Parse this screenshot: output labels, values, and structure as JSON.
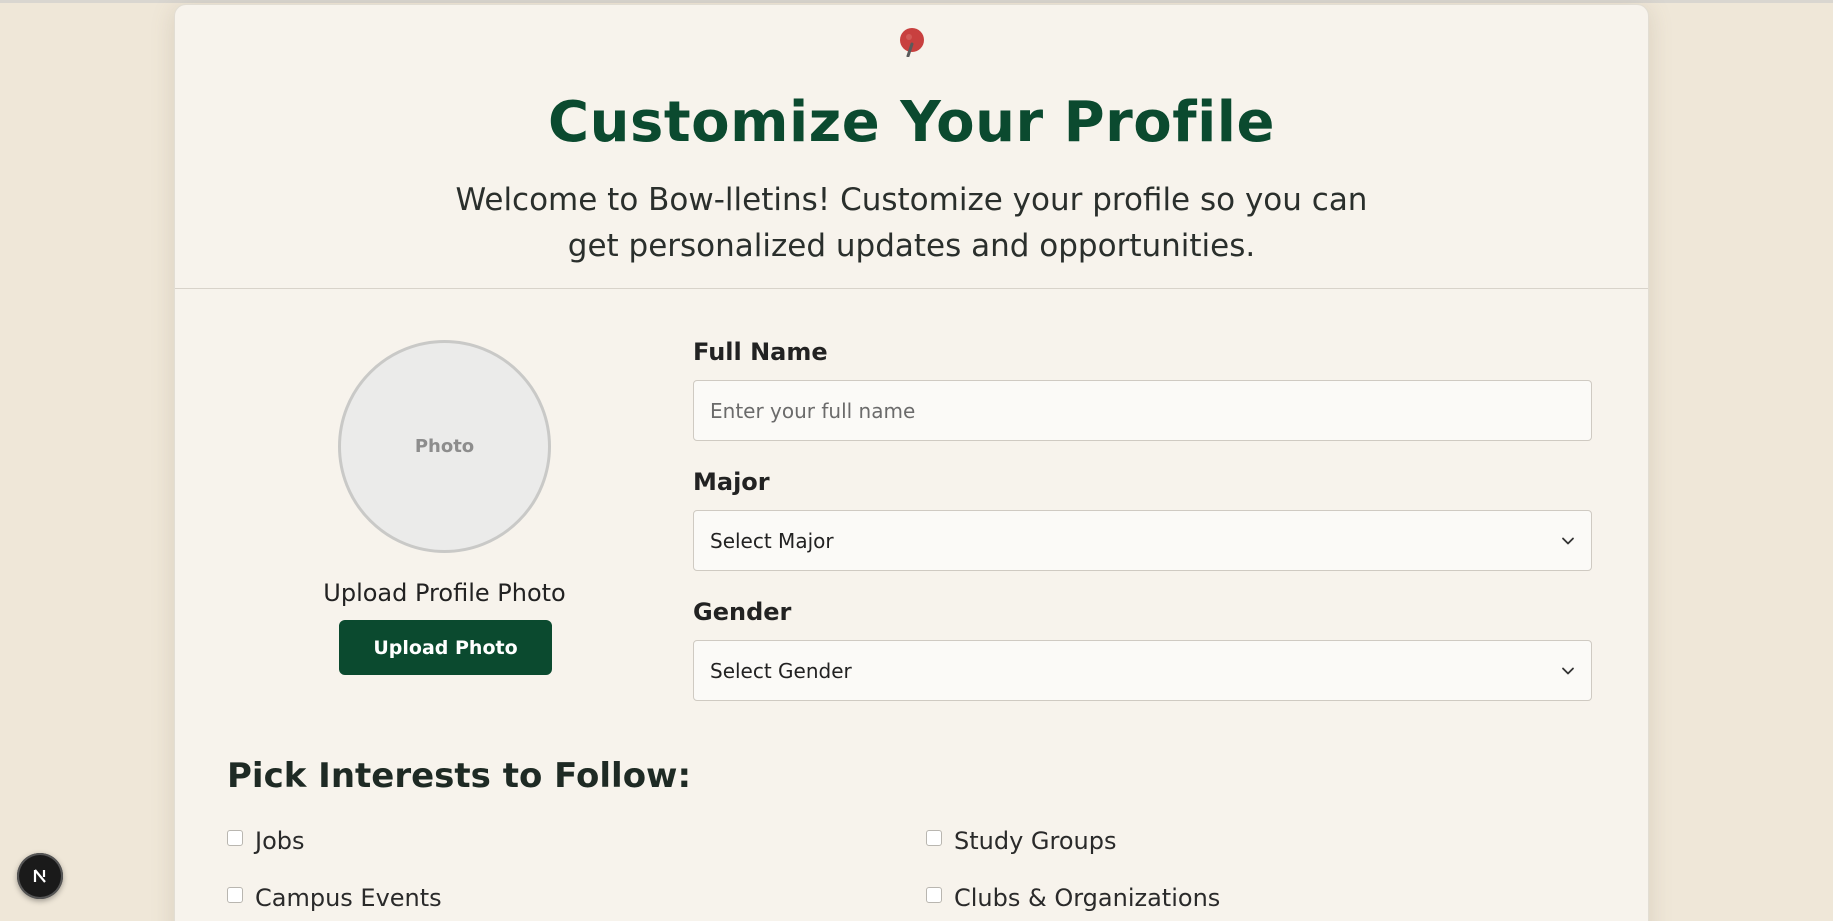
{
  "header": {
    "title": "Customize Your Profile",
    "subtitle": "Welcome to Bow-lletins! Customize your profile so you can get personalized updates and opportunities."
  },
  "photo": {
    "placeholder": "Photo",
    "upload_label": "Upload Profile Photo",
    "upload_button": "Upload Photo"
  },
  "form": {
    "full_name": {
      "label": "Full Name",
      "placeholder": "Enter your full name",
      "value": ""
    },
    "major": {
      "label": "Major",
      "selected": "Select Major"
    },
    "gender": {
      "label": "Gender",
      "selected": "Select Gender"
    }
  },
  "interests": {
    "title": "Pick Interests to Follow:",
    "items": [
      {
        "label": "Jobs",
        "checked": false
      },
      {
        "label": "Study Groups",
        "checked": false
      },
      {
        "label": "Campus Events",
        "checked": false
      },
      {
        "label": "Clubs & Organizations",
        "checked": false
      }
    ]
  },
  "icons": {
    "pin": "pushpin-icon",
    "chevron": "chevron-down-icon",
    "dev_badge": "nextjs-logo-icon"
  },
  "colors": {
    "brand_green": "#0b4a2f",
    "pin_red": "#c8403f",
    "page_bg": "#efe7d8",
    "card_bg": "#f7f3ec"
  }
}
